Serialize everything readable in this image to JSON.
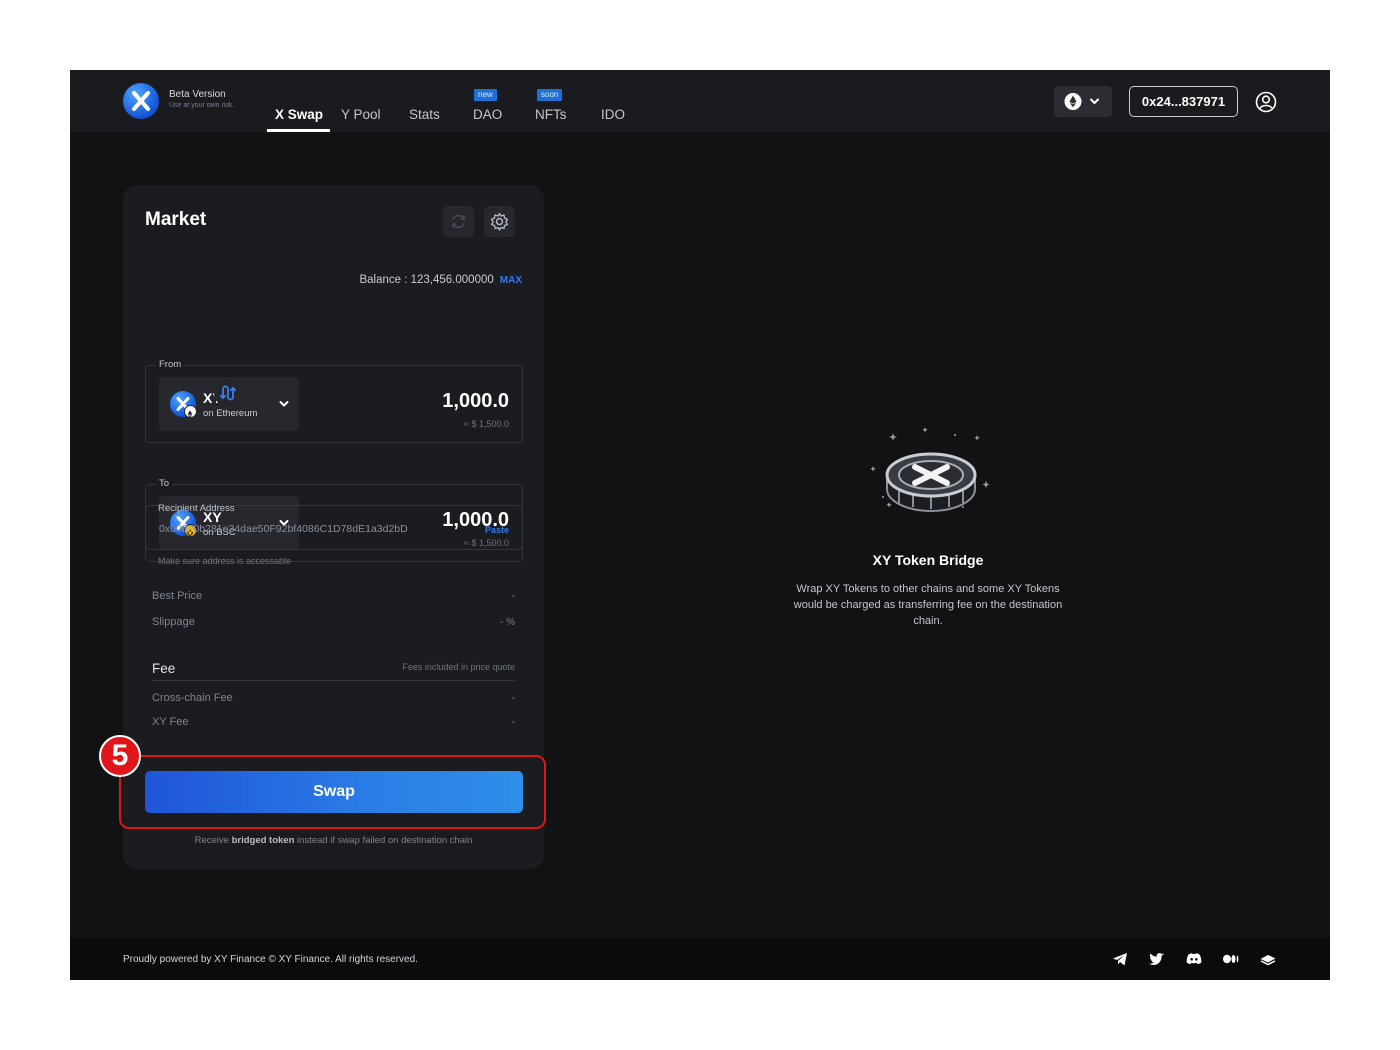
{
  "header": {
    "beta_title": "Beta Version",
    "beta_subtitle": "Use at your own risk.",
    "nav": [
      {
        "label": "X Swap",
        "active": true
      },
      {
        "label": "Y Pool"
      },
      {
        "label": "Stats"
      },
      {
        "label": "DAO",
        "badge": "new"
      },
      {
        "label": "NFTs",
        "badge": "soon"
      },
      {
        "label": "IDO"
      }
    ],
    "network_icon": "ethereum-icon",
    "wallet": "0x24...837971"
  },
  "card": {
    "title": "Market",
    "balance_label": "Balance : 123,456.000000",
    "max": "MAX",
    "from": {
      "label": "From",
      "symbol": "XY",
      "chain": "on Ethereum",
      "amount": "1,000.0",
      "usd": "≈ $ 1,500.0"
    },
    "to": {
      "label": "To",
      "symbol": "XY",
      "chain": "on BSC",
      "amount": "1,000.0",
      "usd": "≈ $ 1,500.0"
    },
    "recipient": {
      "label": "Recipient Address",
      "value": "0x00620b281e34dae50F92bf4086C1D78dE1a3d2bD",
      "paste": "Paste",
      "hint": "Make sure address is accessable"
    },
    "best_price": {
      "label": "Best Price",
      "value": "-"
    },
    "slippage": {
      "label": "Slippage",
      "value": "- %"
    },
    "fee": {
      "title": "Fee",
      "note": "Fees included in price quote",
      "cross_chain": {
        "label": "Cross-chain Fee",
        "value": "-"
      },
      "xy_fee": {
        "label": "XY Fee",
        "value": "-"
      }
    },
    "swap_label": "Swap",
    "swap_note_prefix": "Receive",
    "swap_note_bold": "bridged token",
    "swap_note_suffix": "instead if swap failed on destination chain"
  },
  "bridge": {
    "title": "XY Token Bridge",
    "description": "Wrap XY Tokens to other chains and some XY Tokens would be charged as transferring fee on the destination chain."
  },
  "footer": {
    "text": "Proudly powered by XY Finance  © XY Finance. All rights reserved.",
    "icons": [
      "telegram-icon",
      "twitter-icon",
      "discord-icon",
      "medium-icon",
      "gitbook-icon"
    ]
  },
  "annotation": {
    "step": "5",
    "color": "#e0151a"
  },
  "colors": {
    "accent": "#2f7bf0",
    "background": "#111214",
    "card": "#1b1c20"
  }
}
